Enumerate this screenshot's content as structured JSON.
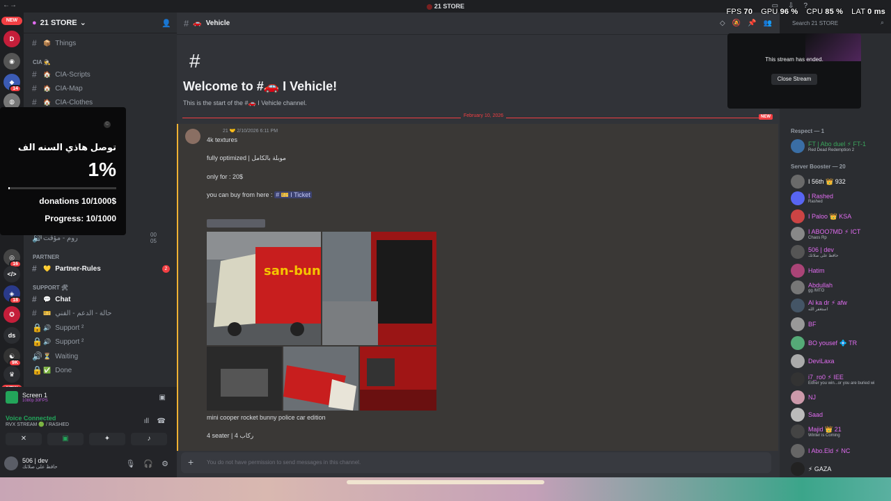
{
  "window": {
    "title": "21 STORE"
  },
  "overlay_stats": [
    {
      "label": "FPS",
      "value": "70"
    },
    {
      "label": "GPU",
      "value": "96 %"
    },
    {
      "label": "CPU",
      "value": "85 %"
    },
    {
      "label": "LAT",
      "value": "0 ms"
    }
  ],
  "rail": {
    "new_label": "NEW",
    "badges": [
      "14",
      "16",
      "18",
      "9K"
    ],
    "ds_label": "ds"
  },
  "server": {
    "name": "21 STORE"
  },
  "channels": [
    {
      "name": "Things",
      "emoji": "📦"
    },
    {
      "category": "CIA 🕵"
    },
    {
      "name": "CIA-Scripts",
      "emoji": "🏠"
    },
    {
      "name": "CIA-Map",
      "emoji": "🏠"
    },
    {
      "name": "CIA-Clothes",
      "emoji": "🏠"
    }
  ],
  "channels_lower": {
    "partner_cat": "Partner",
    "partner_rules": "Partner-Rules",
    "partner_unread": "2",
    "support_cat": "SUPPORT 🛠",
    "chat": "Chat",
    "support_ar": "حالة - الدعم - الفني",
    "support2a": "Support ²",
    "support2b": "Support ²",
    "waiting": "Waiting",
    "done": "Done",
    "hidden_voice": "روم - مؤقت",
    "hidden_counts": "00 05"
  },
  "donation": {
    "title": "توصل هاذي السنه الف",
    "percent": "1%",
    "progress_fraction": 0.01,
    "donations": "donations 10/1000$",
    "progress": "Progress: 10/1000"
  },
  "voice": {
    "screen_title": "Screen 1",
    "screen_sub": "1080p 30FPS",
    "connected": "Voice Connected",
    "location": "RVX STREAM 🟢 / RASHED"
  },
  "user": {
    "name": "506 | dev",
    "status": "حافظ على صلاتك"
  },
  "channel": {
    "name": "Vehicle",
    "emoji": "🚗",
    "welcome": "Welcome to #🚗 I Vehicle!",
    "welcome_sub": "This is the start of the #🚗 I Vehicle channel.",
    "date_divider": "February 10, 2026",
    "new_badge": "NEW"
  },
  "message": {
    "meta": "21 🤝 2/10/2026 6:11 PM",
    "lines": [
      "4k textures",
      "fully optimized | موبلة بالكامل",
      "only for : 20$",
      "you can buy from here :",
      "mini cooper rocket bunny police car edition",
      "4 seater | 4 ركاب"
    ],
    "ticket_mention": "# 🎫 I Ticket"
  },
  "chatbox": {
    "placeholder": "You do not have permission to send messages in this channel."
  },
  "search": {
    "placeholder": "Search 21 STORE"
  },
  "stream": {
    "message": "This stream has ended.",
    "close_label": "Close Stream"
  },
  "members": {
    "groups": [
      {
        "label": "Respect — 1"
      },
      {
        "label": "Server Booster — 20"
      }
    ],
    "list": [
      {
        "name": "FT | Abo duel ⚡ FT-1",
        "status": "Red Dead Redemption 2",
        "color": "#3ba55c"
      },
      {
        "name": "I 56th 👑 932",
        "status": "",
        "color": "#f2f3f5"
      },
      {
        "name": "I Rashed",
        "status": "Rashed",
        "color": "#e06cf0"
      },
      {
        "name": "I Paloo 👑 KSA",
        "status": "",
        "color": "#e06cf0"
      },
      {
        "name": "I ABOO7MD ⚡ ICT",
        "status": "Chaos Rp",
        "color": "#e06cf0"
      },
      {
        "name": "506 | dev",
        "status": "حافظ على صلاتك",
        "color": "#e06cf0"
      },
      {
        "name": "Hatim",
        "status": "",
        "color": "#e06cf0"
      },
      {
        "name": "Abdullah",
        "status": "gg /MTO",
        "color": "#e06cf0"
      },
      {
        "name": "Al ka dr ⚡ afw",
        "status": "استغفر الله",
        "color": "#e06cf0"
      },
      {
        "name": "BF",
        "status": "",
        "color": "#e06cf0"
      },
      {
        "name": "BO yousef 💠 TR",
        "status": "",
        "color": "#e06cf0"
      },
      {
        "name": "DeviLaxa",
        "status": "",
        "color": "#e06cf0"
      },
      {
        "name": "i7_ro0 ⚡ IEE",
        "status": "Either you win...or you are buried wi",
        "color": "#e06cf0"
      },
      {
        "name": "NJ",
        "status": "",
        "color": "#e06cf0"
      },
      {
        "name": "Saad",
        "status": "",
        "color": "#e06cf0"
      },
      {
        "name": "Majid 👑 21",
        "status": "Winter is Coming",
        "color": "#e06cf0"
      },
      {
        "name": "I Abo.Eld ⚡ NC",
        "status": "",
        "color": "#e06cf0"
      },
      {
        "name": "⚡ GAZA",
        "status": "",
        "color": "#f2f3f5"
      }
    ]
  }
}
